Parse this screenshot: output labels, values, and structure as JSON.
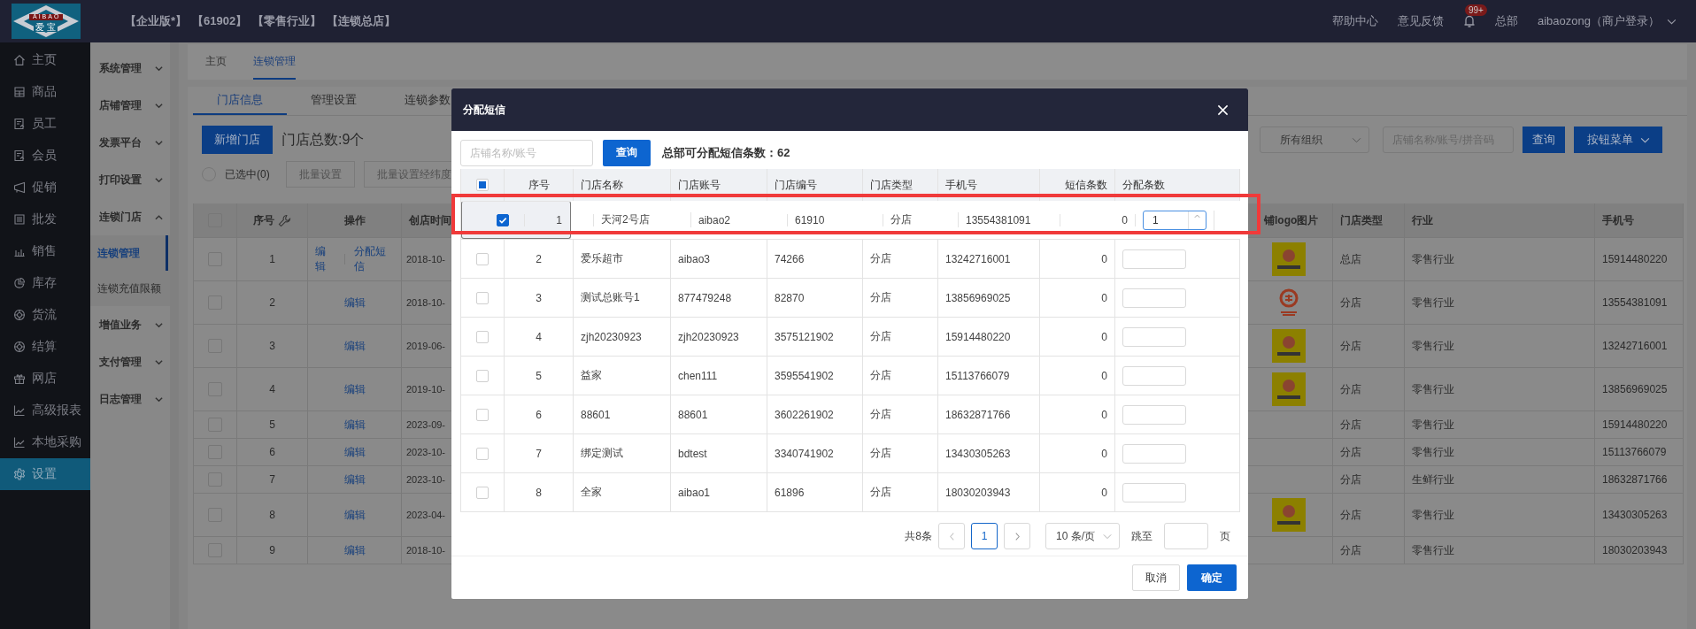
{
  "header": {
    "logo_text": "AIBAO",
    "logo_subtext": "爱 宝",
    "tags": [
      "【企业版*】",
      "【61902】",
      "【零售行业】",
      "【连锁总店】"
    ],
    "links": [
      "帮助中心",
      "意见反馈"
    ],
    "notification_badge": "99+",
    "org": "总部",
    "user": "aibaozong（商户登录）"
  },
  "main_nav": [
    {
      "label": "主页",
      "selected": false
    },
    {
      "label": "商品",
      "selected": false
    },
    {
      "label": "员工",
      "selected": false
    },
    {
      "label": "会员",
      "selected": false
    },
    {
      "label": "促销",
      "selected": false
    },
    {
      "label": "批发",
      "selected": false
    },
    {
      "label": "销售",
      "selected": false
    },
    {
      "label": "库存",
      "selected": false
    },
    {
      "label": "货流",
      "selected": false
    },
    {
      "label": "结算",
      "selected": false
    },
    {
      "label": "网店",
      "selected": false
    },
    {
      "label": "高级报表",
      "selected": false
    },
    {
      "label": "本地采购",
      "selected": false
    },
    {
      "label": "设置",
      "selected": true
    }
  ],
  "sub_nav": [
    {
      "label": "系统管理",
      "expanded": false
    },
    {
      "label": "店铺管理",
      "expanded": false
    },
    {
      "label": "发票平台",
      "expanded": false
    },
    {
      "label": "打印设置",
      "expanded": false
    },
    {
      "label": "连锁门店",
      "expanded": true,
      "children": [
        {
          "label": "连锁管理",
          "selected": true
        },
        {
          "label": "连锁充值限额",
          "selected": false
        }
      ]
    },
    {
      "label": "增值业务",
      "expanded": false
    },
    {
      "label": "支付管理",
      "expanded": false
    },
    {
      "label": "日志管理",
      "expanded": false
    }
  ],
  "page_tabs": [
    {
      "label": "主页",
      "selected": false
    },
    {
      "label": "连锁管理",
      "selected": true
    }
  ],
  "content_tabs": [
    {
      "label": "门店信息",
      "selected": true
    },
    {
      "label": "管理设置",
      "selected": false
    },
    {
      "label": "连锁参数",
      "selected": false
    }
  ],
  "toolbar": {
    "add_button": "新增门店",
    "store_count": "门店总数:9个",
    "select_radio": {
      "checked": false
    },
    "selected_label": "已选中(0)",
    "batch_buttons": [
      {
        "label": "批量设置",
        "disabled": true
      },
      {
        "label": "批量设置经纬度",
        "disabled": true
      }
    ],
    "org_select": "所有组织",
    "search_placeholder": "店铺名称/账号/拼音码",
    "query_button": "查询",
    "menu_button": "按钮菜单"
  },
  "store_table": {
    "select_all": {
      "checked": false
    },
    "columns": [
      "序号",
      "操作",
      "创店时间",
      "铺logo图片",
      "门店类型",
      "行业",
      "手机号"
    ],
    "rows": [
      {
        "no": "1",
        "actions": [
          "编辑",
          "分配短信"
        ],
        "created": "2018-10-",
        "kind": "square_logo",
        "checked": false,
        "type": "总店",
        "industry": "零售行业",
        "phone": "15914480220"
      },
      {
        "no": "2",
        "actions": [
          "编辑"
        ],
        "created": "2018-10-",
        "kind": "round_logo",
        "checked": false,
        "type": "分店",
        "industry": "零售行业",
        "phone": "13554381091"
      },
      {
        "no": "3",
        "actions": [
          "编辑"
        ],
        "created": "2019-06-",
        "kind": "square_logo",
        "checked": false,
        "type": "分店",
        "industry": "零售行业",
        "phone": "13242716001"
      },
      {
        "no": "4",
        "actions": [
          "编辑"
        ],
        "created": "2019-10-",
        "kind": "square_logo",
        "checked": false,
        "type": "分店",
        "industry": "零售行业",
        "phone": "13856969025"
      },
      {
        "no": "5",
        "actions": [
          "编辑"
        ],
        "created": "2023-09-",
        "kind": "plain",
        "checked": false,
        "type": "分店",
        "industry": "零售行业",
        "phone": "15914480220"
      },
      {
        "no": "6",
        "actions": [
          "编辑"
        ],
        "created": "2023-10-",
        "kind": "plain",
        "checked": false,
        "type": "分店",
        "industry": "零售行业",
        "phone": "15113766079"
      },
      {
        "no": "7",
        "actions": [
          "编辑"
        ],
        "created": "2023-10-",
        "kind": "plain",
        "checked": false,
        "type": "分店",
        "industry": "生鲜行业",
        "phone": "18632871766"
      },
      {
        "no": "8",
        "actions": [
          "编辑"
        ],
        "created": "2023-04-",
        "kind": "square_logo",
        "checked": false,
        "type": "分店",
        "industry": "零售行业",
        "phone": "13430305263"
      },
      {
        "no": "9",
        "actions": [
          "编辑"
        ],
        "created": "2018-10-",
        "kind": "plain",
        "checked": false,
        "type": "分店",
        "industry": "零售行业",
        "phone": "18030203943"
      }
    ]
  },
  "dialog": {
    "title": "分配短信",
    "search_placeholder": "店铺名称/账号",
    "query_button": "查询",
    "quota": "总部可分配短信条数：62",
    "select_all": {
      "indeterminate": true
    },
    "columns": [
      "序号",
      "门店名称",
      "门店账号",
      "门店编号",
      "门店类型",
      "手机号",
      "短信条数",
      "分配条数"
    ],
    "rows": [
      {
        "no": "1",
        "name": "天河2号店",
        "account": "aibao2",
        "code": "61910",
        "type": "分店",
        "phone": "13554381091",
        "sms_count": "0",
        "allocate": "1",
        "checked": true,
        "selected": true,
        "focused": true
      },
      {
        "no": "2",
        "name": "爱乐超市",
        "account": "aibao3",
        "code": "74266",
        "type": "分店",
        "phone": "13242716001",
        "sms_count": "0",
        "checked": false,
        "selected": false,
        "focused": false
      },
      {
        "no": "3",
        "name": "测试总账号1",
        "account": "877479248",
        "code": "82870",
        "type": "分店",
        "phone": "13856969025",
        "sms_count": "0",
        "checked": false,
        "selected": false,
        "focused": false
      },
      {
        "no": "4",
        "name": "zjh20230923",
        "account": "zjh20230923",
        "code": "3575121902",
        "type": "分店",
        "phone": "15914480220",
        "sms_count": "0",
        "checked": false,
        "selected": false,
        "focused": false
      },
      {
        "no": "5",
        "name": "益家",
        "account": "chen111",
        "code": "3595541902",
        "type": "分店",
        "phone": "15113766079",
        "sms_count": "0",
        "checked": false,
        "selected": false,
        "focused": false
      },
      {
        "no": "6",
        "name": "88601",
        "account": "88601",
        "code": "3602261902",
        "type": "分店",
        "phone": "18632871766",
        "sms_count": "0",
        "checked": false,
        "selected": false,
        "focused": false
      },
      {
        "no": "7",
        "name": "绑定测试",
        "account": "bdtest",
        "code": "3340741902",
        "type": "分店",
        "phone": "13430305263",
        "sms_count": "0",
        "checked": false,
        "selected": false,
        "focused": false
      },
      {
        "no": "8",
        "name": "全家",
        "account": "aibao1",
        "code": "61896",
        "type": "分店",
        "phone": "18030203943",
        "sms_count": "0",
        "checked": false,
        "selected": false,
        "focused": false
      }
    ],
    "pagination": {
      "total": "共8条",
      "pages": [
        {
          "label": "1",
          "selected": true
        }
      ],
      "page_size": "10 条/页",
      "jump_label": "跳至",
      "page_suffix": "页"
    },
    "buttons": {
      "cancel": "取消",
      "confirm": "确定"
    }
  }
}
